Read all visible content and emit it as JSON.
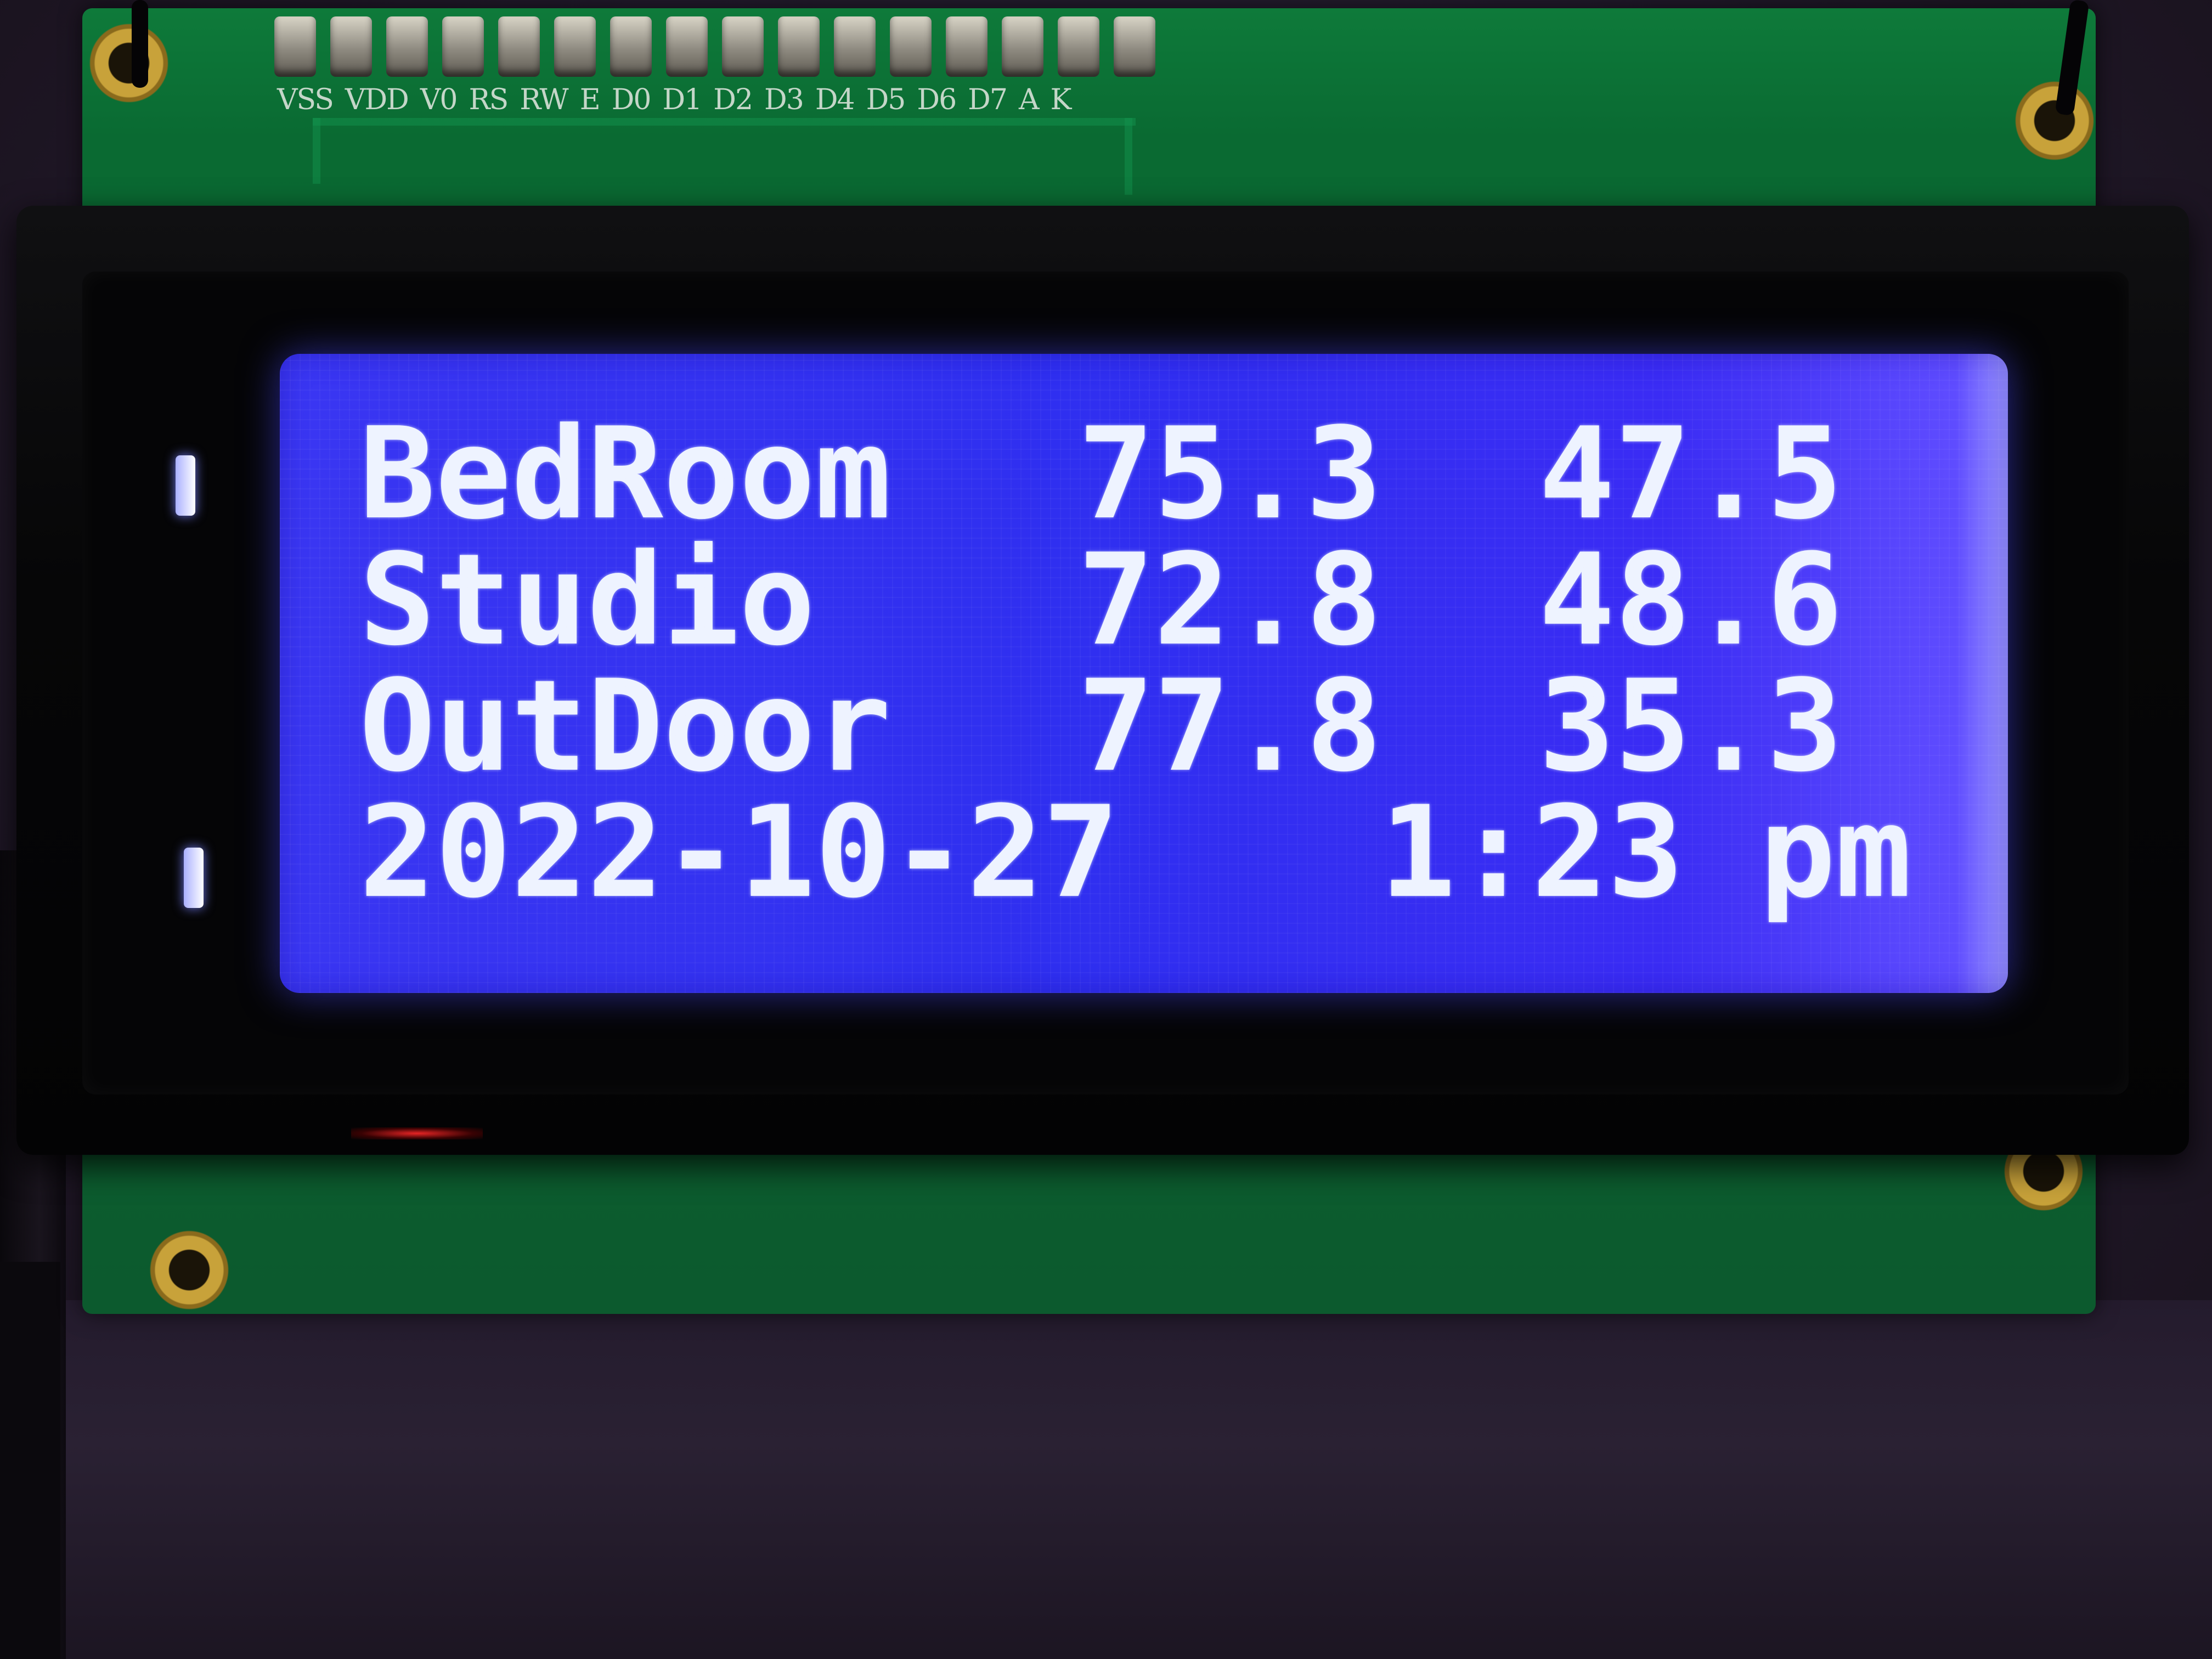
{
  "pcb": {
    "pin_labels": [
      "VSS",
      "VDD",
      "V0",
      "RS",
      "RW",
      "E",
      "D0",
      "D1",
      "D2",
      "D3",
      "D4",
      "D5",
      "D6",
      "D7",
      "A",
      "K"
    ]
  },
  "lcd": {
    "rows": [
      {
        "name": "BedRoom",
        "temperature": "75.3",
        "humidity": "47.5"
      },
      {
        "name": "Studio",
        "temperature": "72.8",
        "humidity": "48.6"
      },
      {
        "name": "OutDoor",
        "temperature": "77.8",
        "humidity": "35.3"
      }
    ],
    "date": "2022-10-27",
    "time": "1:23 pm"
  },
  "colors": {
    "backlight": "#3a36f2",
    "pixel_text": "#eef3ff",
    "pcb_green": "#0c6a32",
    "bezel": "#050506"
  }
}
